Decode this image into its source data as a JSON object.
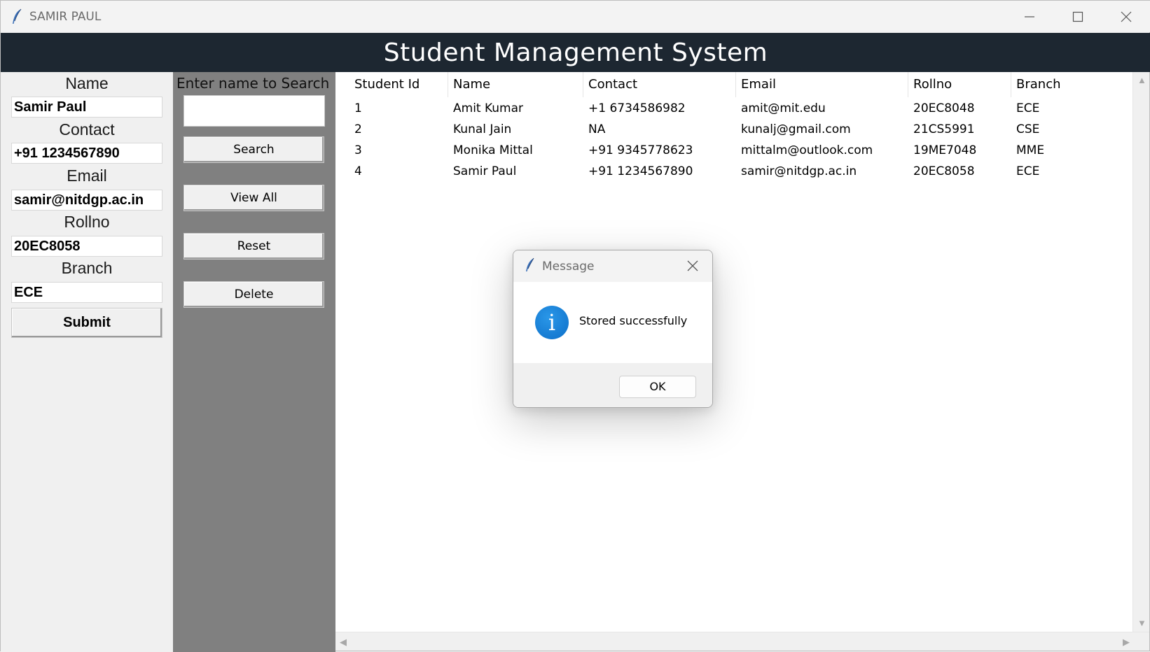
{
  "window": {
    "title": "SAMIR PAUL",
    "controls": [
      "minimize-icon",
      "maximize-icon",
      "close-icon"
    ]
  },
  "header": {
    "title": "Student Management System"
  },
  "form": {
    "fields": [
      {
        "label": "Name",
        "value": "Samir Paul"
      },
      {
        "label": "Contact",
        "value": "+91 1234567890"
      },
      {
        "label": "Email",
        "value": "samir@nitdgp.ac.in"
      },
      {
        "label": "Rollno",
        "value": "20EC8058"
      },
      {
        "label": "Branch",
        "value": "ECE"
      }
    ],
    "submit_label": "Submit"
  },
  "search": {
    "label": "Enter name to Search",
    "value": "",
    "buttons": {
      "search": "Search",
      "view_all": "View All",
      "reset": "Reset",
      "delete": "Delete"
    }
  },
  "table": {
    "columns": [
      "Student Id",
      "Name",
      "Contact",
      "Email",
      "Rollno",
      "Branch"
    ],
    "rows": [
      [
        "1",
        "Amit Kumar",
        "+1 6734586982",
        "amit@mit.edu",
        "20EC8048",
        "ECE"
      ],
      [
        "2",
        "Kunal Jain",
        "NA",
        "kunalj@gmail.com",
        "21CS5991",
        "CSE"
      ],
      [
        "3",
        "Monika Mittal",
        "+91 9345778623",
        "mittalm@outlook.com",
        "19ME7048",
        "MME"
      ],
      [
        "4",
        "Samir Paul",
        "+91 1234567890",
        "samir@nitdgp.ac.in",
        "20EC8058",
        "ECE"
      ]
    ]
  },
  "dialog": {
    "title": "Message",
    "icon": "info-icon",
    "message": "Stored successfully",
    "ok_label": "OK"
  },
  "colors": {
    "header_bg": "#1d2731",
    "search_panel_bg": "#808080",
    "info_blue": "#0d6fc9"
  }
}
